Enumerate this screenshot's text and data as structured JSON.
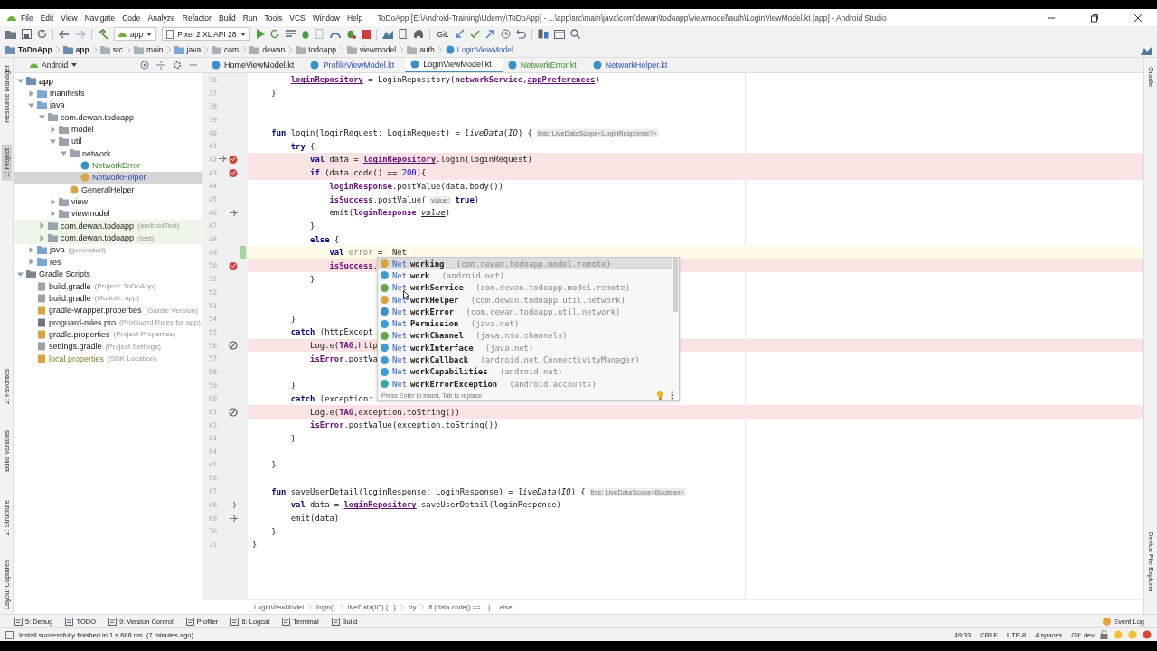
{
  "window": {
    "title": "ToDoApp [E:\\Android-Training\\Udemy\\ToDoApp] - ...\\app\\src\\main\\java\\com\\dewan\\todoapp\\viewmodel\\auth\\LoginViewModel.kt [app] - Android Studio",
    "menu": [
      "File",
      "Edit",
      "View",
      "Navigate",
      "Code",
      "Analyze",
      "Refactor",
      "Build",
      "Run",
      "Tools",
      "VCS",
      "Window",
      "Help"
    ]
  },
  "toolbar": {
    "run_config": "app",
    "device": "Pixel 2 XL API 28",
    "vcs_label": "Git:"
  },
  "navigation_bar": [
    {
      "label": "ToDoApp",
      "kind": "project"
    },
    {
      "label": "app",
      "kind": "module"
    },
    {
      "label": "src",
      "kind": "folder"
    },
    {
      "label": "main",
      "kind": "folder"
    },
    {
      "label": "java",
      "kind": "source"
    },
    {
      "label": "com",
      "kind": "folder"
    },
    {
      "label": "dewan",
      "kind": "folder"
    },
    {
      "label": "todoapp",
      "kind": "folder"
    },
    {
      "label": "viewmodel",
      "kind": "folder"
    },
    {
      "label": "auth",
      "kind": "folder"
    },
    {
      "label": "LoginViewModel",
      "kind": "class"
    }
  ],
  "left_tool_strip": [
    {
      "label": "Resource Manager",
      "selected": false
    },
    {
      "label": "1: Project",
      "selected": true
    },
    {
      "label": "2: Favorites",
      "selected": false
    },
    {
      "label": "Build Variants",
      "selected": false
    },
    {
      "label": "Z: Structure",
      "selected": false
    },
    {
      "label": "Layout Captures",
      "selected": false
    }
  ],
  "right_tool_strip": [
    "Gradle",
    "Device File Explorer"
  ],
  "project": {
    "view": "Android",
    "tree": [
      {
        "label": "app",
        "kind": "module",
        "expanded": true,
        "selected": false,
        "children": [
          {
            "label": "manifests",
            "kind": "folder",
            "expanded": false,
            "selected": false
          },
          {
            "label": "java",
            "kind": "folder",
            "expanded": true,
            "selected": false,
            "children": [
              {
                "label": "com.dewan.todoapp",
                "kind": "package",
                "expanded": true,
                "selected": false,
                "children": [
                  {
                    "label": "model",
                    "kind": "package",
                    "expanded": false,
                    "selected": false
                  },
                  {
                    "label": "util",
                    "kind": "package",
                    "expanded": true,
                    "selected": false,
                    "children": [
                      {
                        "label": "network",
                        "kind": "package",
                        "expanded": true,
                        "selected": false,
                        "children": [
                          {
                            "label": "NetworkError",
                            "kind": "kotlin-class",
                            "selected": false,
                            "added": true
                          },
                          {
                            "label": "NetworkHelper",
                            "kind": "object",
                            "selected": true,
                            "modified": true
                          }
                        ]
                      },
                      {
                        "label": "GeneralHelper",
                        "kind": "object",
                        "selected": false
                      }
                    ]
                  },
                  {
                    "label": "view",
                    "kind": "package",
                    "expanded": false,
                    "selected": false
                  },
                  {
                    "label": "viewmodel",
                    "kind": "package",
                    "expanded": false,
                    "selected": false
                  }
                ]
              },
              {
                "label": "com.dewan.todoapp",
                "note": "(androidTest)",
                "kind": "test-package",
                "expanded": false,
                "selected": false
              },
              {
                "label": "com.dewan.todoapp",
                "note": "(test)",
                "kind": "test-package",
                "expanded": false,
                "selected": false
              }
            ]
          },
          {
            "label": "java",
            "note": "(generated)",
            "kind": "generated",
            "expanded": false,
            "selected": false
          },
          {
            "label": "res",
            "kind": "folder",
            "expanded": false,
            "selected": false
          }
        ]
      },
      {
        "label": "Gradle Scripts",
        "kind": "gradle-root",
        "expanded": true,
        "selected": false,
        "children": [
          {
            "label": "build.gradle",
            "note": "(Project: ToDoApp)",
            "kind": "gradle",
            "selected": false
          },
          {
            "label": "build.gradle",
            "note": "(Module: app)",
            "kind": "gradle",
            "selected": false
          },
          {
            "label": "gradle-wrapper.properties",
            "note": "(Gradle Version)",
            "kind": "properties",
            "selected": false
          },
          {
            "label": "proguard-rules.pro",
            "note": "(ProGuard Rules for app)",
            "kind": "file",
            "selected": false
          },
          {
            "label": "gradle.properties",
            "note": "(Project Properties)",
            "kind": "properties",
            "selected": false
          },
          {
            "label": "settings.gradle",
            "note": "(Project Settings)",
            "kind": "gradle",
            "selected": false
          },
          {
            "label": "local.properties",
            "note": "(SDK Location)",
            "kind": "properties",
            "selected": false,
            "ignored": true
          }
        ]
      }
    ]
  },
  "tabs": [
    {
      "label": "HomeViewModel.kt",
      "selected": false,
      "modified": false,
      "added": false
    },
    {
      "label": "ProfileViewModel.kt",
      "selected": false,
      "modified": true
    },
    {
      "label": "LoginViewModel.kt",
      "selected": true,
      "modified": false,
      "added": false
    },
    {
      "label": "NetworkError.kt",
      "selected": false,
      "added": true
    },
    {
      "label": "NetworkHelper.kt",
      "selected": false,
      "modified": true
    }
  ],
  "editor": {
    "lines": [
      {
        "n": "36",
        "kind": "plain",
        "code": [
          {
            "kind": "fu",
            "t": "        loginRepository"
          },
          {
            "kind": "p",
            "t": " = LoginRepository("
          },
          {
            "kind": "f",
            "t": "networkService"
          },
          {
            "kind": "p",
            "t": ","
          },
          {
            "kind": "fu",
            "t": "appPreferences"
          },
          {
            "kind": "p",
            "t": ")"
          }
        ]
      },
      {
        "n": "37",
        "kind": "plain",
        "code": [
          {
            "kind": "p",
            "t": "    }"
          }
        ]
      },
      {
        "n": "38",
        "kind": "plain"
      },
      {
        "n": "39",
        "kind": "plain"
      },
      {
        "n": "40",
        "kind": "plain",
        "code": [
          {
            "kind": "kw",
            "t": "    fun"
          },
          {
            "kind": "p",
            "t": " login(loginRequest: LoginRequest) = "
          },
          {
            "kind": "i",
            "t": "liveData"
          },
          {
            "kind": "p",
            "t": "("
          },
          {
            "kind": "i",
            "t": "IO"
          },
          {
            "kind": "p",
            "t": ") {"
          },
          {
            "kind": "hint",
            "t": "this: LiveDataScope<LoginResponse?>"
          }
        ]
      },
      {
        "n": "41",
        "kind": "plain",
        "code": [
          {
            "kind": "kw",
            "t": "        try"
          },
          {
            "kind": "p",
            "t": " {"
          }
        ]
      },
      {
        "n": "42",
        "kind": "breakpoint",
        "gutter": [
          {
            "kind": "lambda"
          },
          {
            "kind": "breakpoint"
          }
        ],
        "code": [
          {
            "kind": "kw",
            "t": "            val"
          },
          {
            "kind": "p",
            "t": " data = "
          },
          {
            "kind": "fu",
            "t": "loginRepository"
          },
          {
            "kind": "p",
            "t": ".login(loginRequest)"
          }
        ]
      },
      {
        "n": "43",
        "kind": "breakpoint",
        "gutter": [
          {
            "kind": "breakpoint"
          }
        ],
        "code": [
          {
            "kind": "kw",
            "t": "            if"
          },
          {
            "kind": "p",
            "t": " (data.code() == "
          },
          {
            "kind": "num",
            "t": "200"
          },
          {
            "kind": "p",
            "t": "){"
          }
        ]
      },
      {
        "n": "44",
        "kind": "plain",
        "code": [
          {
            "kind": "f",
            "t": "                loginResponse"
          },
          {
            "kind": "p",
            "t": ".postValue(data.body())"
          }
        ]
      },
      {
        "n": "45",
        "kind": "plain",
        "code": [
          {
            "kind": "f",
            "t": "                isSuccess"
          },
          {
            "kind": "p",
            "t": ".postValue("
          },
          {
            "kind": "hint",
            "t": "value:"
          },
          {
            "kind": "kw",
            "t": "true"
          },
          {
            "kind": "p",
            "t": ")"
          }
        ]
      },
      {
        "n": "46",
        "kind": "plain",
        "gutter": [
          {
            "kind": "lambda"
          }
        ],
        "code": [
          {
            "kind": "p",
            "t": "                emit("
          },
          {
            "kind": "f",
            "t": "loginResponse"
          },
          {
            "kind": "p",
            "t": "."
          },
          {
            "kind": "iu",
            "t": "value"
          },
          {
            "kind": "p",
            "t": ")"
          }
        ]
      },
      {
        "n": "47",
        "kind": "plain",
        "code": [
          {
            "kind": "p",
            "t": "            }"
          }
        ]
      },
      {
        "n": "48",
        "kind": "plain",
        "code": [
          {
            "kind": "kw",
            "t": "            else"
          },
          {
            "kind": "p",
            "t": " {"
          }
        ]
      },
      {
        "n": "49",
        "kind": "caret",
        "code": [
          {
            "kind": "kw",
            "t": "                val"
          },
          {
            "kind": "unused",
            "t": "error"
          },
          {
            "kind": "p",
            "t": " =  Net"
          }
        ]
      },
      {
        "n": "50",
        "kind": "breakpoint",
        "gutter": [
          {
            "kind": "breakpoint"
          }
        ],
        "code": [
          {
            "kind": "f",
            "t": "                isSuccess"
          },
          {
            "kind": "p",
            "t": "."
          }
        ]
      },
      {
        "n": "51",
        "kind": "plain",
        "code": [
          {
            "kind": "p",
            "t": "            }"
          }
        ]
      },
      {
        "n": "52",
        "kind": "plain"
      },
      {
        "n": "53",
        "kind": "plain"
      },
      {
        "n": "54",
        "kind": "plain",
        "code": [
          {
            "kind": "p",
            "t": "        }"
          }
        ]
      },
      {
        "n": "55",
        "kind": "plain",
        "code": [
          {
            "kind": "kw",
            "t": "        catch"
          },
          {
            "kind": "p",
            "t": " (httpExcept"
          }
        ]
      },
      {
        "n": "56",
        "kind": "breakpoint",
        "gutter": [
          {
            "kind": "disabled"
          }
        ],
        "code": [
          {
            "kind": "p",
            "t": "            Log.e("
          },
          {
            "kind": "f",
            "t": "TAG"
          },
          {
            "kind": "p",
            "t": ",http"
          }
        ]
      },
      {
        "n": "57",
        "kind": "plain",
        "code": [
          {
            "kind": "f",
            "t": "            isError"
          },
          {
            "kind": "p",
            "t": ".postVa"
          }
        ]
      },
      {
        "n": "58",
        "kind": "plain"
      },
      {
        "n": "59",
        "kind": "plain",
        "code": [
          {
            "kind": "p",
            "t": "        }"
          }
        ]
      },
      {
        "n": "60",
        "kind": "plain",
        "code": [
          {
            "kind": "kw",
            "t": "        catch"
          },
          {
            "kind": "p",
            "t": " (exception:"
          }
        ]
      },
      {
        "n": "61",
        "kind": "breakpoint",
        "gutter": [
          {
            "kind": "disabled"
          }
        ],
        "code": [
          {
            "kind": "p",
            "t": "            Log.e("
          },
          {
            "kind": "f",
            "t": "TAG"
          },
          {
            "kind": "p",
            "t": ",exception.toString())"
          }
        ]
      },
      {
        "n": "62",
        "kind": "plain",
        "code": [
          {
            "kind": "f",
            "t": "            isError"
          },
          {
            "kind": "p",
            "t": ".postValue(exception.toString())"
          }
        ]
      },
      {
        "n": "63",
        "kind": "plain",
        "code": [
          {
            "kind": "p",
            "t": "        }"
          }
        ]
      },
      {
        "n": "64",
        "kind": "plain"
      },
      {
        "n": "65",
        "kind": "plain",
        "code": [
          {
            "kind": "p",
            "t": "    }"
          }
        ]
      },
      {
        "n": "66",
        "kind": "plain"
      },
      {
        "n": "67",
        "kind": "plain",
        "code": [
          {
            "kind": "kw",
            "t": "    fun"
          },
          {
            "kind": "p",
            "t": " saveUserDetail(loginResponse: LoginResponse) = "
          },
          {
            "kind": "i",
            "t": "liveData"
          },
          {
            "kind": "p",
            "t": "("
          },
          {
            "kind": "i",
            "t": "IO"
          },
          {
            "kind": "p",
            "t": ") {"
          },
          {
            "kind": "hint",
            "t": "this: LiveDataScope<Boolean>"
          }
        ]
      },
      {
        "n": "68",
        "kind": "plain",
        "gutter": [
          {
            "kind": "lambda"
          }
        ],
        "code": [
          {
            "kind": "kw",
            "t": "        val"
          },
          {
            "kind": "p",
            "t": " data = "
          },
          {
            "kind": "fu",
            "t": "loginRepository"
          },
          {
            "kind": "p",
            "t": ".saveUserDetail(loginResponse)"
          }
        ]
      },
      {
        "n": "69",
        "kind": "plain",
        "gutter": [
          {
            "kind": "lambda"
          }
        ],
        "code": [
          {
            "kind": "p",
            "t": "        emit(data)"
          }
        ]
      },
      {
        "n": "70",
        "kind": "plain",
        "code": [
          {
            "kind": "p",
            "t": "    }"
          }
        ]
      },
      {
        "n": "71",
        "kind": "plain",
        "code": [
          {
            "kind": "p",
            "t": "}"
          }
        ]
      }
    ],
    "completion": {
      "items": [
        {
          "match": "Net",
          "rest": "working",
          "detail": "(com.dewan.todoapp.model.remote)",
          "color": "#d9a343",
          "selected": true
        },
        {
          "match": "Net",
          "rest": "work",
          "detail": "(android.net)",
          "color": "#3e9bd4",
          "selected": false
        },
        {
          "match": "Net",
          "rest": "workService",
          "detail": "(com.dewan.todoapp.model.remote)",
          "color": "#62a84a",
          "selected": false
        },
        {
          "match": "Net",
          "rest": "workHelper",
          "detail": "(com.dewan.todoapp.util.network)",
          "color": "#d9a343",
          "selected": false
        },
        {
          "match": "Net",
          "rest": "workError",
          "detail": "(com.dewan.todoapp.util.network)",
          "color": "#3a8fc4",
          "selected": false
        },
        {
          "match": "Net",
          "rest": "Permission",
          "detail": "(java.net)",
          "color": "#3e9bd4",
          "selected": false
        },
        {
          "match": "Net",
          "rest": "workChannel",
          "detail": "(java.nio.channels)",
          "color": "#62a84a",
          "selected": false
        },
        {
          "match": "Net",
          "rest": "workInterface",
          "detail": "(java.net)",
          "color": "#3e9bd4",
          "selected": false
        },
        {
          "match": "Net",
          "rest": "workCallback",
          "detail": "(android.net.ConnectivityManager)",
          "color": "#3e9bd4",
          "selected": false
        },
        {
          "match": "Net",
          "rest": "workCapabilities",
          "detail": "(android.net)",
          "color": "#3e9bd4",
          "selected": false
        },
        {
          "match": "Net",
          "rest": "workErrorException",
          "detail": "(android.accounts)",
          "color": "#35a7b0",
          "selected": false
        }
      ],
      "footer": "Press Enter to insert, Tab to replace"
    },
    "breadcrumbs": [
      "LoginViewModel",
      "login()",
      "liveData(IO) {...}",
      "try",
      "if (data.code() == ...) ... else"
    ]
  },
  "tool_windows": [
    "5: Debug",
    "TODO",
    "9: Version Control",
    "Profiler",
    "6: Logcat",
    "Terminal",
    "Build"
  ],
  "event_log": "Event Log",
  "status_bar": {
    "message": "Install successfully finished in 1 s 688 ms. (7 minutes ago)",
    "position": "49:33",
    "line_separator": "CRLF",
    "encoding": "UTF-8",
    "indent": "4 spaces",
    "vcs_branch": "Git: dev"
  }
}
